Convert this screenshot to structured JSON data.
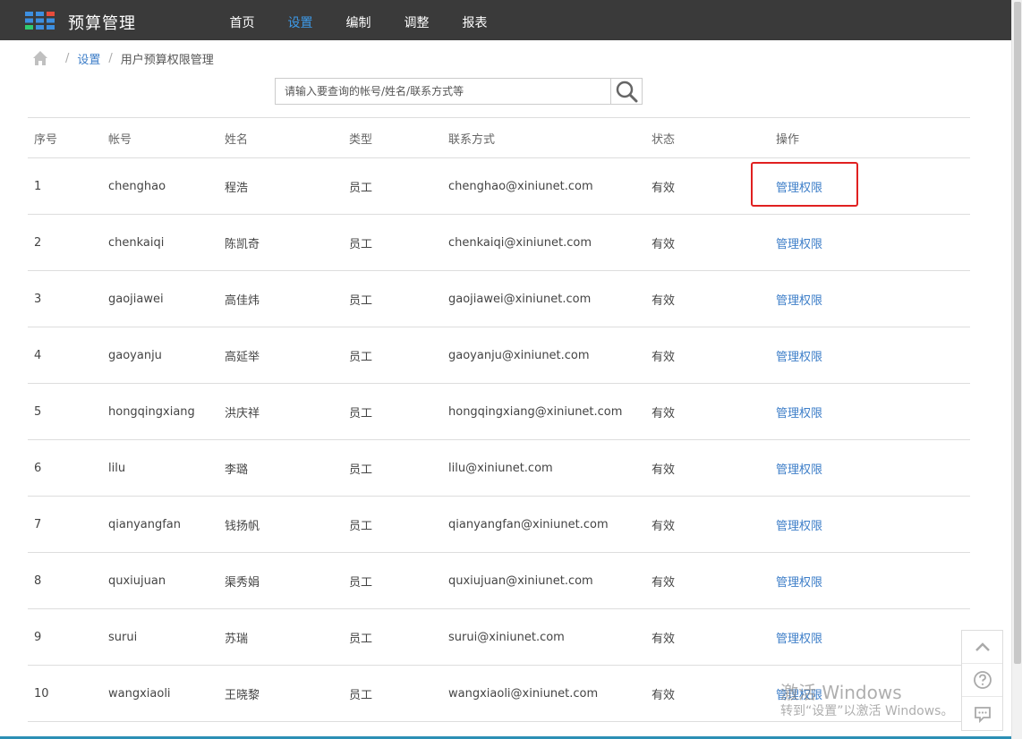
{
  "app": {
    "title": "预算管理"
  },
  "nav": {
    "items": [
      {
        "label": "首页",
        "active": false
      },
      {
        "label": "设置",
        "active": true
      },
      {
        "label": "编制",
        "active": false
      },
      {
        "label": "调整",
        "active": false
      },
      {
        "label": "报表",
        "active": false
      }
    ]
  },
  "breadcrumb": {
    "home_icon": "home-icon",
    "link": "设置",
    "current": "用户预算权限管理"
  },
  "search": {
    "placeholder": "请输入要查询的帐号/姓名/联系方式等",
    "value": "",
    "icon": "search-icon"
  },
  "table": {
    "headers": [
      "序号",
      "帐号",
      "姓名",
      "类型",
      "联系方式",
      "状态",
      "操作"
    ],
    "rows": [
      {
        "no": "1",
        "account": "chenghao",
        "name": "程浩",
        "type": "员工",
        "contact": "chenghao@xiniunet.com",
        "status": "有效",
        "action": "管理权限"
      },
      {
        "no": "2",
        "account": "chenkaiqi",
        "name": "陈凯奇",
        "type": "员工",
        "contact": "chenkaiqi@xiniunet.com",
        "status": "有效",
        "action": "管理权限"
      },
      {
        "no": "3",
        "account": "gaojiawei",
        "name": "高佳炜",
        "type": "员工",
        "contact": "gaojiawei@xiniunet.com",
        "status": "有效",
        "action": "管理权限"
      },
      {
        "no": "4",
        "account": "gaoyanju",
        "name": "高延举",
        "type": "员工",
        "contact": "gaoyanju@xiniunet.com",
        "status": "有效",
        "action": "管理权限"
      },
      {
        "no": "5",
        "account": "hongqingxiang",
        "name": "洪庆祥",
        "type": "员工",
        "contact": "hongqingxiang@xiniunet.com",
        "status": "有效",
        "action": "管理权限"
      },
      {
        "no": "6",
        "account": "lilu",
        "name": "李璐",
        "type": "员工",
        "contact": "lilu@xiniunet.com",
        "status": "有效",
        "action": "管理权限"
      },
      {
        "no": "7",
        "account": "qianyangfan",
        "name": "钱扬帆",
        "type": "员工",
        "contact": "qianyangfan@xiniunet.com",
        "status": "有效",
        "action": "管理权限"
      },
      {
        "no": "8",
        "account": "quxiujuan",
        "name": "渠秀娟",
        "type": "员工",
        "contact": "quxiujuan@xiniunet.com",
        "status": "有效",
        "action": "管理权限"
      },
      {
        "no": "9",
        "account": "surui",
        "name": "苏瑞",
        "type": "员工",
        "contact": "surui@xiniunet.com",
        "status": "有效",
        "action": "管理权限"
      },
      {
        "no": "10",
        "account": "wangxiaoli",
        "name": "王晓黎",
        "type": "员工",
        "contact": "wangxiaoli@xiniunet.com",
        "status": "有效",
        "action": "管理权限"
      }
    ]
  },
  "float_tools": [
    "chevron-up-icon",
    "help-icon",
    "feedback-icon"
  ],
  "watermark": {
    "line1": "激活 Windows",
    "line2": "转到“设置”以激活 Windows。"
  },
  "colors": {
    "topbar": "#3a3a3a",
    "nav_active": "#3d9bea",
    "link": "#3d7ec8",
    "highlight": "#e02020"
  }
}
